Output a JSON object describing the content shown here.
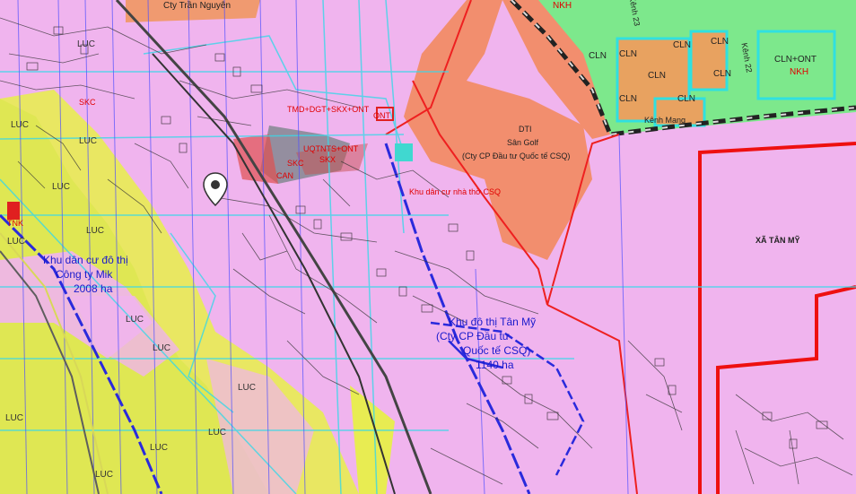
{
  "map": {
    "labels": {
      "cty_tran_nguyen": "Cty Trần Nguyên",
      "nkh_top": "NKH",
      "kenh_23": "Kênh 23",
      "kenh_22": "Kênh 22",
      "kenh_mang": "Kênh Mang",
      "cln_ont": "CLN+ONT",
      "nkh_right": "NKH",
      "dti": "DTI",
      "san_golf": "Sân Golf",
      "san_golf_company": "(Cty CP Đầu tư Quốc tế CSQ)",
      "kdc_csq": "Khu dân cư nhà thờ CSQ",
      "xa_tan_my": "XÃ TÂN MỸ",
      "kdt_left_1": "Khu dân cư đô thị",
      "kdt_left_2": "Công ty Mik",
      "kdt_left_3": "2008 ha",
      "kdt_tanmy_1": "Khu đô thị Tân Mỹ",
      "kdt_tanmy_2": "(Cty CP Đầu tư",
      "kdt_tanmy_3": "Quốc tế CSQ)",
      "kdt_tanmy_4": "1140 ha",
      "skc": "SKC",
      "can": "CAN",
      "skx": "SKX",
      "tmd_dgt": "TMD+DGT+SKX+ONT",
      "ontts": "UQTNTS+ONT",
      "ont": "ONT",
      "tnk": "TNK",
      "luc": "LUC",
      "cln": "CLN",
      "sk": "SKC"
    }
  }
}
